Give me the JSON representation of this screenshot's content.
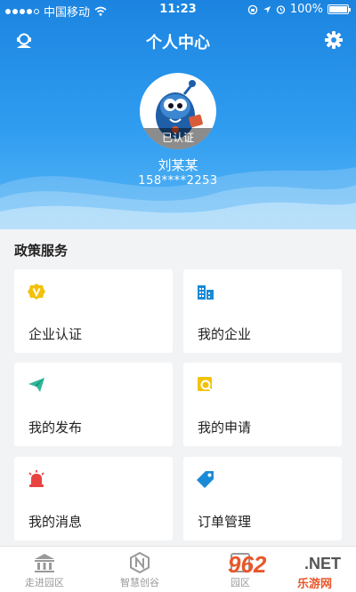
{
  "status_bar": {
    "carrier": "中国移动",
    "time": "11:23",
    "battery": "100%",
    "battery_level": 1.0,
    "signal_bars": 4,
    "signal_total": 5
  },
  "nav": {
    "title": "个人中心",
    "left_icon": "user-service-icon",
    "right_icon": "gear-icon"
  },
  "profile": {
    "badge": "已认证",
    "name": "刘某某",
    "phone": "158****2253"
  },
  "policy_section": {
    "title": "政策服务",
    "items": [
      {
        "label": "企业认证",
        "icon": "vip-badge-icon",
        "color": "#f2c20a"
      },
      {
        "label": "我的企业",
        "icon": "building-icon",
        "color": "#1a8ad6"
      },
      {
        "label": "我的发布",
        "icon": "paper-plane-icon",
        "color": "#2fb89a"
      },
      {
        "label": "我的申请",
        "icon": "search-doc-icon",
        "color": "#f2c20a"
      },
      {
        "label": "我的消息",
        "icon": "alarm-bell-icon",
        "color": "#e8433f"
      },
      {
        "label": "订单管理",
        "icon": "tag-icon",
        "color": "#1a8ad6"
      }
    ]
  },
  "tabbar": {
    "items": [
      {
        "label": "走进园区",
        "icon": "museum-icon"
      },
      {
        "label": "智慧创谷",
        "icon": "hex-n-icon"
      },
      {
        "label": "园区",
        "icon": "grid-icon"
      }
    ]
  },
  "watermark": {
    "logo": "962",
    "net": ".NET",
    "sub": "乐游网"
  },
  "colors": {
    "header_blue": "#1b84e0",
    "background": "#f2f3f5",
    "card": "#ffffff"
  }
}
